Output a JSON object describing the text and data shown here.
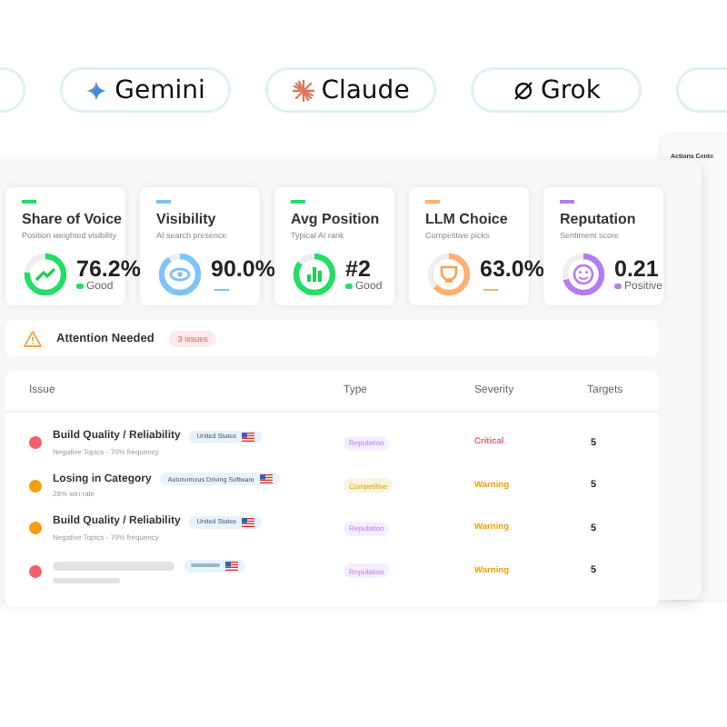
{
  "models": [
    {
      "label": "Gemini",
      "kind": "gemini"
    },
    {
      "label": "Claude",
      "kind": "claude"
    },
    {
      "label": "Grok",
      "kind": "grok"
    }
  ],
  "side_panel": {
    "title": "Actions Cente"
  },
  "metrics": [
    {
      "title": "Share of Voice",
      "subtitle": "Position weighted visibility",
      "value": "76.2%",
      "status": "Good",
      "color": "#22dd66"
    },
    {
      "title": "Visibility",
      "subtitle": "AI search presence",
      "value": "90.0%",
      "color": "#7cc4fa"
    },
    {
      "title": "Avg Position",
      "subtitle": "Typical AI rank",
      "value": "#2",
      "status": "Good",
      "color": "#22dd66"
    },
    {
      "title": "LLM Choice",
      "subtitle": "Competitive picks",
      "value": "63.0%",
      "color": "#ffb070"
    },
    {
      "title": "Reputation",
      "subtitle": "Sentiment score",
      "value": "0.21",
      "status": "Positive",
      "color": "#b57cf5"
    }
  ],
  "attention": {
    "title": "Attention Needed",
    "count": "3 issues"
  },
  "table": {
    "columns": [
      "Issue",
      "Type",
      "Severity",
      "Targets"
    ],
    "rows": [
      {
        "kind": "issue",
        "color": "#f4606a",
        "title": "Build Quality / Reliability",
        "detail": "Negative Topics - 70% frequency",
        "region": "United States",
        "type": {
          "label": "Reputation",
          "kind": "reputation"
        },
        "severity": {
          "label": "Critical",
          "kind": "critical"
        },
        "targets": "5"
      },
      {
        "kind": "issue",
        "color": "#f59e0b",
        "title": "Losing in Category",
        "detail": "28% win rate",
        "region": "Autonomous Driving Software",
        "type": {
          "label": "Competitive",
          "kind": "competitive"
        },
        "severity": {
          "label": "Warning",
          "kind": "warning"
        },
        "targets": "5"
      },
      {
        "kind": "issue",
        "color": "#f59e0b",
        "title": "Build Quality / Reliability",
        "detail": "Negative Topics - 70% frequency",
        "region": "United States",
        "type": {
          "label": "Reputation",
          "kind": "reputation"
        },
        "severity": {
          "label": "Warning",
          "kind": "warning"
        },
        "targets": "5"
      },
      {
        "kind": "skeleton",
        "color": "#f4606a",
        "type": {
          "label": "Reputation",
          "kind": "reputation"
        },
        "severity": {
          "label": "Warning",
          "kind": "warning"
        },
        "targets": "5"
      }
    ]
  }
}
